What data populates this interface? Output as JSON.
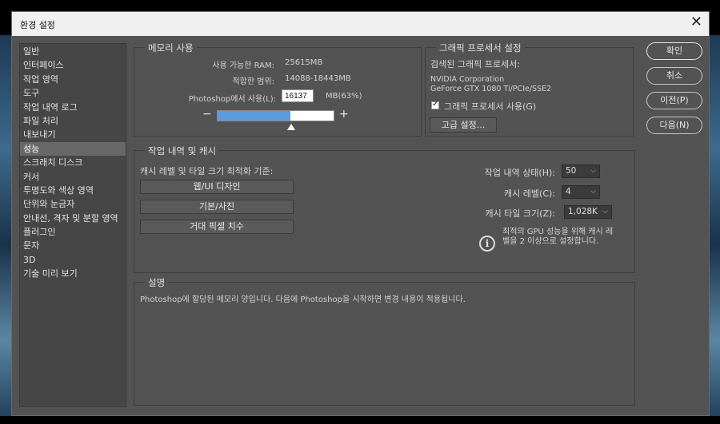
{
  "window": {
    "title": "환경 설정",
    "close_glyph": "✕"
  },
  "sidebar": {
    "items": [
      {
        "label": "일반"
      },
      {
        "label": "인터페이스"
      },
      {
        "label": "작업 영역"
      },
      {
        "label": "도구"
      },
      {
        "label": "작업 내역 로그"
      },
      {
        "label": "파일 처리"
      },
      {
        "label": "내보내기"
      },
      {
        "label": "성능",
        "active": true
      },
      {
        "label": "스크래치 디스크"
      },
      {
        "label": "커서"
      },
      {
        "label": "투명도와 색상 영역"
      },
      {
        "label": "단위와 눈금자"
      },
      {
        "label": "안내선, 격자 및 분할 영역"
      },
      {
        "label": "플러그인"
      },
      {
        "label": "문자"
      },
      {
        "label": "3D"
      },
      {
        "label": "기술 미리 보기"
      }
    ]
  },
  "memory": {
    "legend": "메모리 사용",
    "available_label": "사용 가능한 RAM:",
    "available_value": "25615MB",
    "ideal_label": "적합한 범위:",
    "ideal_value": "14088-18443MB",
    "use_label": "Photoshop에서 사용(L):",
    "use_value": "16137",
    "use_suffix": "MB(63%)",
    "usage_fraction": 0.63,
    "minus": "−",
    "plus": "+"
  },
  "graphics": {
    "legend": "그래픽 프로세서 설정",
    "detected_label": "검색된 그래픽 프로세서:",
    "gpu_line1": "NVIDIA Corporation",
    "gpu_line2": "GeForce GTX 1080 Ti/PCIe/SSE2",
    "use_gpu_label": "그래픽 프로세서 사용(G)",
    "use_gpu_checked": true,
    "advanced_button": "고급 설정..."
  },
  "history": {
    "legend": "작업 내역 및 캐시",
    "optimize_label": "캐시 레벨 및 타일 크기 최적화 기준:",
    "buttons": [
      "웹/UI 디자인",
      "기본/사진",
      "거대 픽셀 치수"
    ],
    "history_states_label": "작업 내역 상태(H):",
    "history_states_value": "50",
    "cache_levels_label": "캐시 레벨(C):",
    "cache_levels_value": "4",
    "cache_tile_label": "캐시 타일 크기(Z):",
    "cache_tile_value": "1,028K",
    "info_line1": "최적의 GPU 성능을 위해 캐시 레",
    "info_line2": "벨을 2 이상으로 설정합니다."
  },
  "description": {
    "legend": "설명",
    "text": "Photoshop에 할당된 메모리 양입니다. 다음에 Photoshop을 시작하면 변경 내용이 적용됩니다."
  },
  "actions": {
    "ok": "확인",
    "cancel": "취소",
    "prev": "이전(P)",
    "next": "다음(N)"
  },
  "colors": {
    "dialog_bg": "#535353",
    "slider_fill": "#5b9bde",
    "sidebar_selected": "#686868"
  }
}
